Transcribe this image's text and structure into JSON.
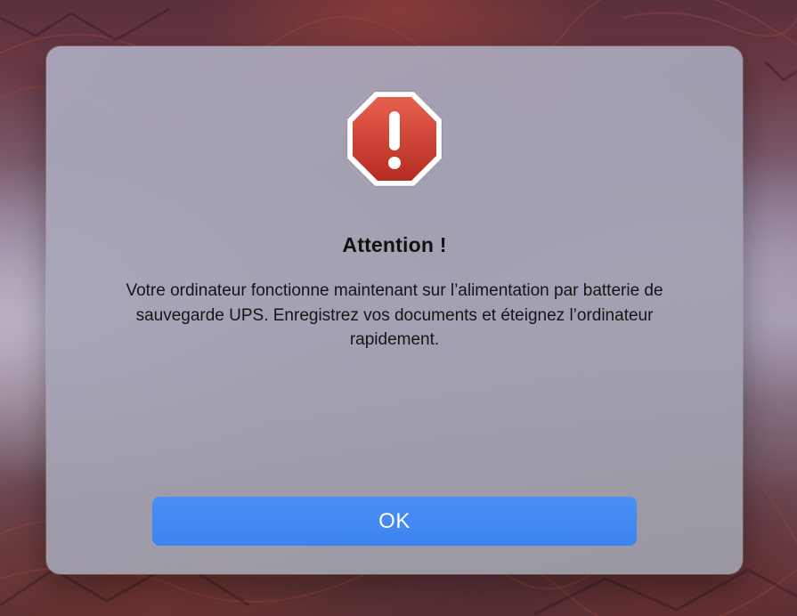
{
  "dialog": {
    "icon": "warning-stop-sign-icon",
    "title": "Attention !",
    "message": "Votre ordinateur fonctionne maintenant sur l’alimentation par batterie de sauvegarde UPS. Enregistrez vos documents et éteignez l’ordinateur rapidement.",
    "ok_label": "OK"
  },
  "colors": {
    "button_accent": "#3d83f0",
    "icon_red": "#c9342a"
  }
}
